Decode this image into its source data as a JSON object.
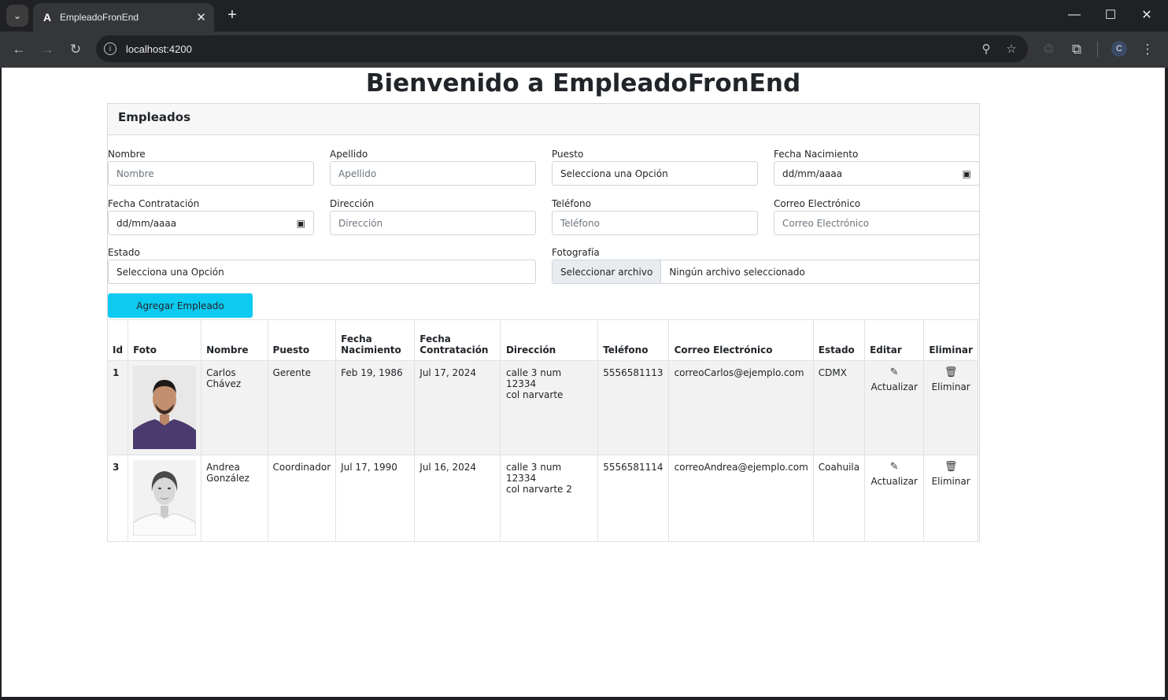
{
  "browser": {
    "tab_title": "EmpleadoFronEnd",
    "favicon": "angular-icon",
    "url": "localhost:4200",
    "profile_initial": "C"
  },
  "page": {
    "title": "Bienvenido a EmpleadoFronEnd",
    "card_header": "Empleados"
  },
  "form": {
    "nombre": {
      "label": "Nombre",
      "placeholder": "Nombre"
    },
    "apellido": {
      "label": "Apellido",
      "placeholder": "Apellido"
    },
    "puesto": {
      "label": "Puesto",
      "value": "Selecciona una Opción"
    },
    "fecha_nacimiento": {
      "label": "Fecha Nacimiento",
      "value": "dd/mm/aaaa"
    },
    "fecha_contratacion": {
      "label": "Fecha Contratación",
      "value": "dd/mm/aaaa"
    },
    "direccion": {
      "label": "Dirección",
      "placeholder": "Dirección"
    },
    "telefono": {
      "label": "Teléfono",
      "placeholder": "Teléfono"
    },
    "correo": {
      "label": "Correo Electrónico",
      "placeholder": "Correo Electrónico"
    },
    "estado": {
      "label": "Estado",
      "value": "Selecciona una Opción"
    },
    "fotografia": {
      "label": "Fotografía",
      "button": "Seleccionar archivo",
      "status": "Ningún archivo seleccionado"
    },
    "submit": "Agregar Empleado"
  },
  "table": {
    "headers": {
      "id": "Id",
      "foto": "Foto",
      "nombre": "Nombre",
      "puesto": "Puesto",
      "fecha_nac_1": "Fecha",
      "fecha_nac_2": "Nacimiento",
      "fecha_con_1": "Fecha",
      "fecha_con_2": "Contratación",
      "direccion": "Dirección",
      "telefono": "Teléfono",
      "correo": "Correo Electrónico",
      "estado": "Estado",
      "editar": "Editar",
      "eliminar": "Eliminar"
    },
    "rows": [
      {
        "id": "1",
        "nombre_1": "Carlos",
        "nombre_2": "Chávez",
        "puesto": "Gerente",
        "fecha_nac": "Feb 19, 1986",
        "fecha_con": "Jul 17, 2024",
        "direccion_1": "calle 3 num 12334",
        "direccion_2": "col narvarte",
        "telefono": "5556581113",
        "correo": "correoCarlos@ejemplo.com",
        "estado": "CDMX",
        "editar": "Actualizar",
        "eliminar": "Eliminar"
      },
      {
        "id": "3",
        "nombre_1": "Andrea",
        "nombre_2": "González",
        "puesto": "Coordinador",
        "fecha_nac": "Jul 17, 1990",
        "fecha_con": "Jul 16, 2024",
        "direccion_1": "calle 3 num 12334",
        "direccion_2": "col narvarte 2",
        "telefono": "5556581114",
        "correo": "correoAndrea@ejemplo.com",
        "estado": "Coahuila",
        "editar": "Actualizar",
        "eliminar": "Eliminar"
      }
    ]
  }
}
